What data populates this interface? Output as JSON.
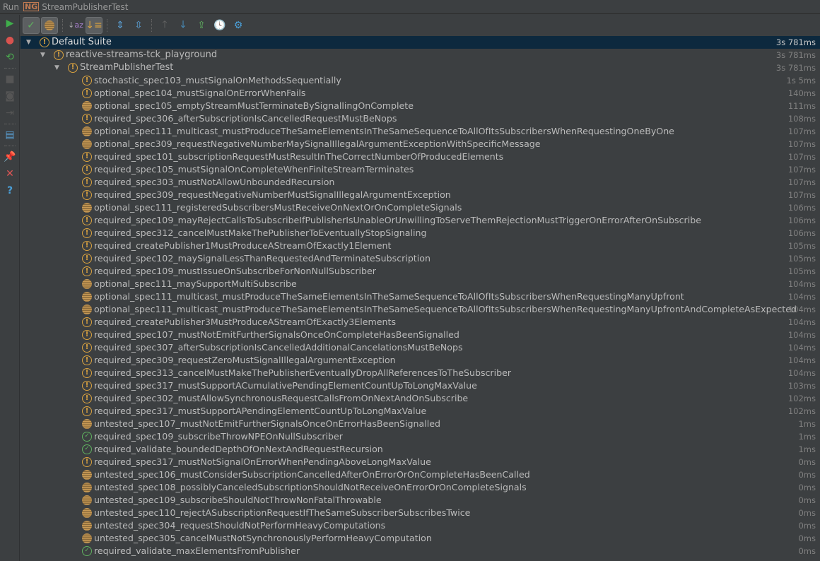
{
  "title": {
    "run_label": "Run",
    "config_name": "StreamPublisherTest"
  },
  "colors": {
    "warn": "#d9a240",
    "ignored": "#c89a55",
    "pass": "#5fb05f",
    "selection": "#0d293e"
  },
  "toolbar": [
    "show-passed",
    "show-ignored",
    "sort-alpha",
    "sort-duration",
    "expand-all",
    "collapse-all",
    "prev-failed",
    "next-failed",
    "export",
    "history",
    "settings"
  ],
  "sidebar": [
    "rerun",
    "rerun-failed",
    "toggle-auto-test",
    "stop",
    "dump-threads",
    "exit",
    "layout",
    "pin",
    "close",
    "help"
  ],
  "tree": [
    {
      "label": "Default Suite",
      "time": "3s 781ms",
      "status": "warn",
      "level": 0
    },
    {
      "label": "reactive-streams-tck_playground",
      "time": "3s 781ms",
      "status": "warn",
      "level": 1
    },
    {
      "label": "StreamPublisherTest",
      "time": "3s 781ms",
      "status": "warn",
      "level": 2
    },
    {
      "label": "stochastic_spec103_mustSignalOnMethodsSequentially",
      "time": "1s 5ms",
      "status": "warn",
      "level": 3
    },
    {
      "label": "optional_spec104_mustSignalOnErrorWhenFails",
      "time": "140ms",
      "status": "warn",
      "level": 3
    },
    {
      "label": "optional_spec105_emptyStreamMustTerminateBySignallingOnComplete",
      "time": "111ms",
      "status": "ignored",
      "level": 3
    },
    {
      "label": "required_spec306_afterSubscriptionIsCancelledRequestMustBeNops",
      "time": "108ms",
      "status": "warn",
      "level": 3
    },
    {
      "label": "optional_spec111_multicast_mustProduceTheSameElementsInTheSameSequenceToAllOfItsSubscribersWhenRequestingOneByOne",
      "time": "107ms",
      "status": "ignored",
      "level": 3
    },
    {
      "label": "optional_spec309_requestNegativeNumberMaySignalIllegalArgumentExceptionWithSpecificMessage",
      "time": "107ms",
      "status": "ignored",
      "level": 3
    },
    {
      "label": "required_spec101_subscriptionRequestMustResultInTheCorrectNumberOfProducedElements",
      "time": "107ms",
      "status": "warn",
      "level": 3
    },
    {
      "label": "required_spec105_mustSignalOnCompleteWhenFiniteStreamTerminates",
      "time": "107ms",
      "status": "warn",
      "level": 3
    },
    {
      "label": "required_spec303_mustNotAllowUnboundedRecursion",
      "time": "107ms",
      "status": "warn",
      "level": 3
    },
    {
      "label": "required_spec309_requestNegativeNumberMustSignalIllegalArgumentException",
      "time": "107ms",
      "status": "warn",
      "level": 3
    },
    {
      "label": "optional_spec111_registeredSubscribersMustReceiveOnNextOrOnCompleteSignals",
      "time": "106ms",
      "status": "ignored",
      "level": 3
    },
    {
      "label": "required_spec109_mayRejectCallsToSubscribeIfPublisherIsUnableOrUnwillingToServeThemRejectionMustTriggerOnErrorAfterOnSubscribe",
      "time": "106ms",
      "status": "warn",
      "level": 3
    },
    {
      "label": "required_spec312_cancelMustMakeThePublisherToEventuallyStopSignaling",
      "time": "106ms",
      "status": "warn",
      "level": 3
    },
    {
      "label": "required_createPublisher1MustProduceAStreamOfExactly1Element",
      "time": "105ms",
      "status": "warn",
      "level": 3
    },
    {
      "label": "required_spec102_maySignalLessThanRequestedAndTerminateSubscription",
      "time": "105ms",
      "status": "warn",
      "level": 3
    },
    {
      "label": "required_spec109_mustIssueOnSubscribeForNonNullSubscriber",
      "time": "105ms",
      "status": "warn",
      "level": 3
    },
    {
      "label": "optional_spec111_maySupportMultiSubscribe",
      "time": "104ms",
      "status": "ignored",
      "level": 3
    },
    {
      "label": "optional_spec111_multicast_mustProduceTheSameElementsInTheSameSequenceToAllOfItsSubscribersWhenRequestingManyUpfront",
      "time": "104ms",
      "status": "ignored",
      "level": 3
    },
    {
      "label": "optional_spec111_multicast_mustProduceTheSameElementsInTheSameSequenceToAllOfItsSubscribersWhenRequestingManyUpfrontAndCompleteAsExpected",
      "time": "104ms",
      "status": "ignored",
      "level": 3
    },
    {
      "label": "required_createPublisher3MustProduceAStreamOfExactly3Elements",
      "time": "104ms",
      "status": "warn",
      "level": 3
    },
    {
      "label": "required_spec107_mustNotEmitFurtherSignalsOnceOnCompleteHasBeenSignalled",
      "time": "104ms",
      "status": "warn",
      "level": 3
    },
    {
      "label": "required_spec307_afterSubscriptionIsCancelledAdditionalCancelationsMustBeNops",
      "time": "104ms",
      "status": "warn",
      "level": 3
    },
    {
      "label": "required_spec309_requestZeroMustSignalIllegalArgumentException",
      "time": "104ms",
      "status": "warn",
      "level": 3
    },
    {
      "label": "required_spec313_cancelMustMakeThePublisherEventuallyDropAllReferencesToTheSubscriber",
      "time": "104ms",
      "status": "warn",
      "level": 3
    },
    {
      "label": "required_spec317_mustSupportACumulativePendingElementCountUpToLongMaxValue",
      "time": "103ms",
      "status": "warn",
      "level": 3
    },
    {
      "label": "required_spec302_mustAllowSynchronousRequestCallsFromOnNextAndOnSubscribe",
      "time": "102ms",
      "status": "warn",
      "level": 3
    },
    {
      "label": "required_spec317_mustSupportAPendingElementCountUpToLongMaxValue",
      "time": "102ms",
      "status": "warn",
      "level": 3
    },
    {
      "label": "untested_spec107_mustNotEmitFurtherSignalsOnceOnErrorHasBeenSignalled",
      "time": "1ms",
      "status": "ignored",
      "level": 3
    },
    {
      "label": "required_spec109_subscribeThrowNPEOnNullSubscriber",
      "time": "1ms",
      "status": "pass",
      "level": 3
    },
    {
      "label": "required_validate_boundedDepthOfOnNextAndRequestRecursion",
      "time": "1ms",
      "status": "pass",
      "level": 3
    },
    {
      "label": "required_spec317_mustNotSignalOnErrorWhenPendingAboveLongMaxValue",
      "time": "0ms",
      "status": "warn",
      "level": 3
    },
    {
      "label": "untested_spec106_mustConsiderSubscriptionCancelledAfterOnErrorOrOnCompleteHasBeenCalled",
      "time": "0ms",
      "status": "ignored",
      "level": 3
    },
    {
      "label": "untested_spec108_possiblyCanceledSubscriptionShouldNotReceiveOnErrorOrOnCompleteSignals",
      "time": "0ms",
      "status": "ignored",
      "level": 3
    },
    {
      "label": "untested_spec109_subscribeShouldNotThrowNonFatalThrowable",
      "time": "0ms",
      "status": "ignored",
      "level": 3
    },
    {
      "label": "untested_spec110_rejectASubscriptionRequestIfTheSameSubscriberSubscribesTwice",
      "time": "0ms",
      "status": "ignored",
      "level": 3
    },
    {
      "label": "untested_spec304_requestShouldNotPerformHeavyComputations",
      "time": "0ms",
      "status": "ignored",
      "level": 3
    },
    {
      "label": "untested_spec305_cancelMustNotSynchronouslyPerformHeavyComputation",
      "time": "0ms",
      "status": "ignored",
      "level": 3
    },
    {
      "label": "required_validate_maxElementsFromPublisher",
      "time": "0ms",
      "status": "pass",
      "level": 3
    }
  ]
}
